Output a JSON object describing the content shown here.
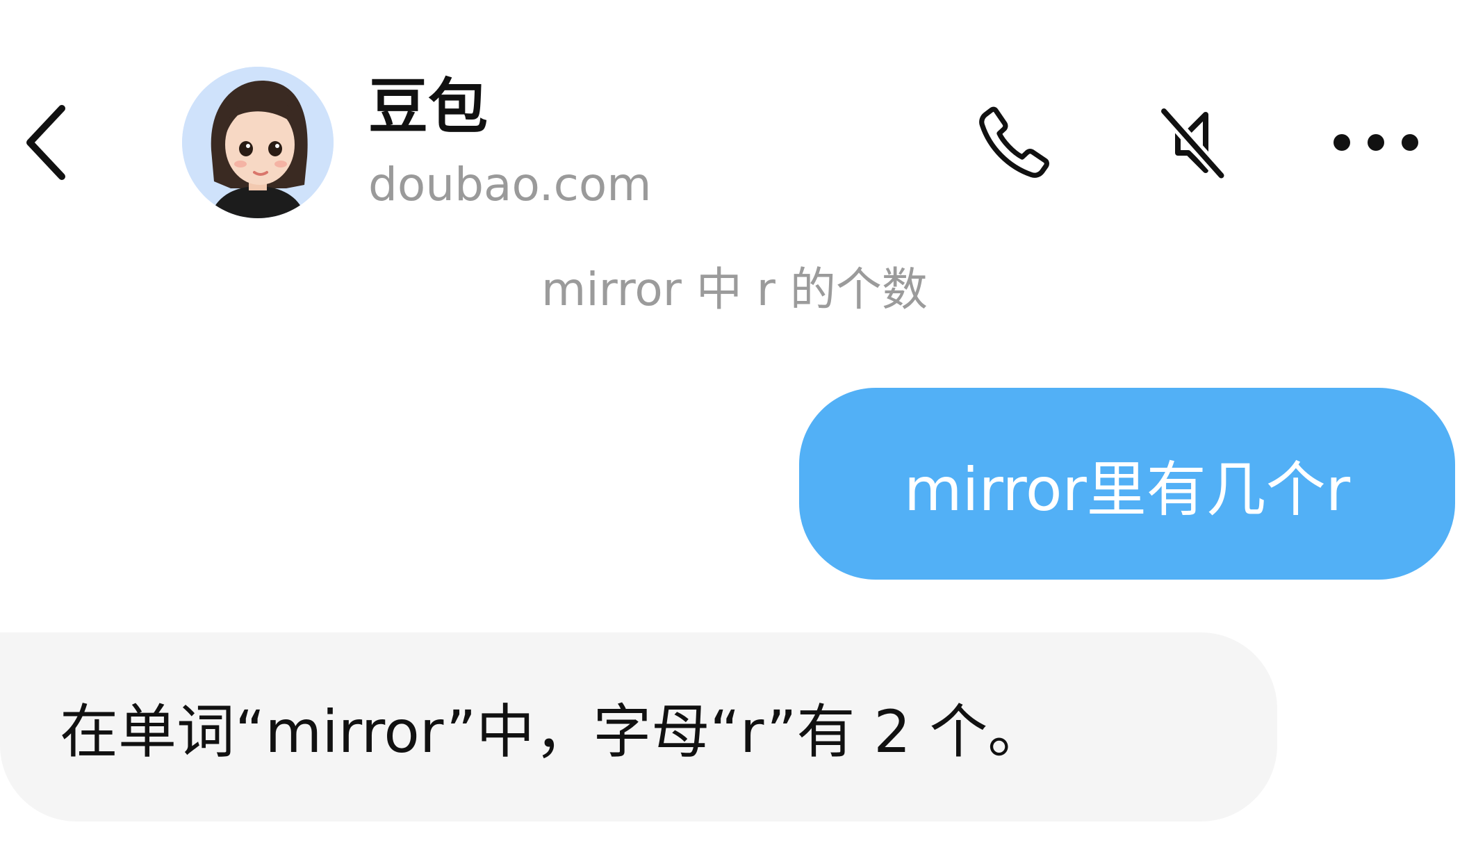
{
  "header": {
    "back_icon": "chevron-left-icon",
    "contact_name": "豆包",
    "contact_subtitle": "doubao.com",
    "avatar_icon": "avatar",
    "actions": {
      "call_icon": "phone-icon",
      "mute_icon": "speaker-muted-icon",
      "more_icon": "more-icon"
    }
  },
  "conversation": {
    "title": "mirror 中 r 的个数"
  },
  "messages": [
    {
      "sender": "user",
      "text": "mirror里有几个r"
    },
    {
      "sender": "assistant",
      "text": "在单词“mirror”中，字母“r”有 2 个。"
    }
  ],
  "colors": {
    "user_bubble": "#52b0f6",
    "assistant_bubble": "#f5f5f5",
    "muted_text": "#9a9a9a"
  }
}
